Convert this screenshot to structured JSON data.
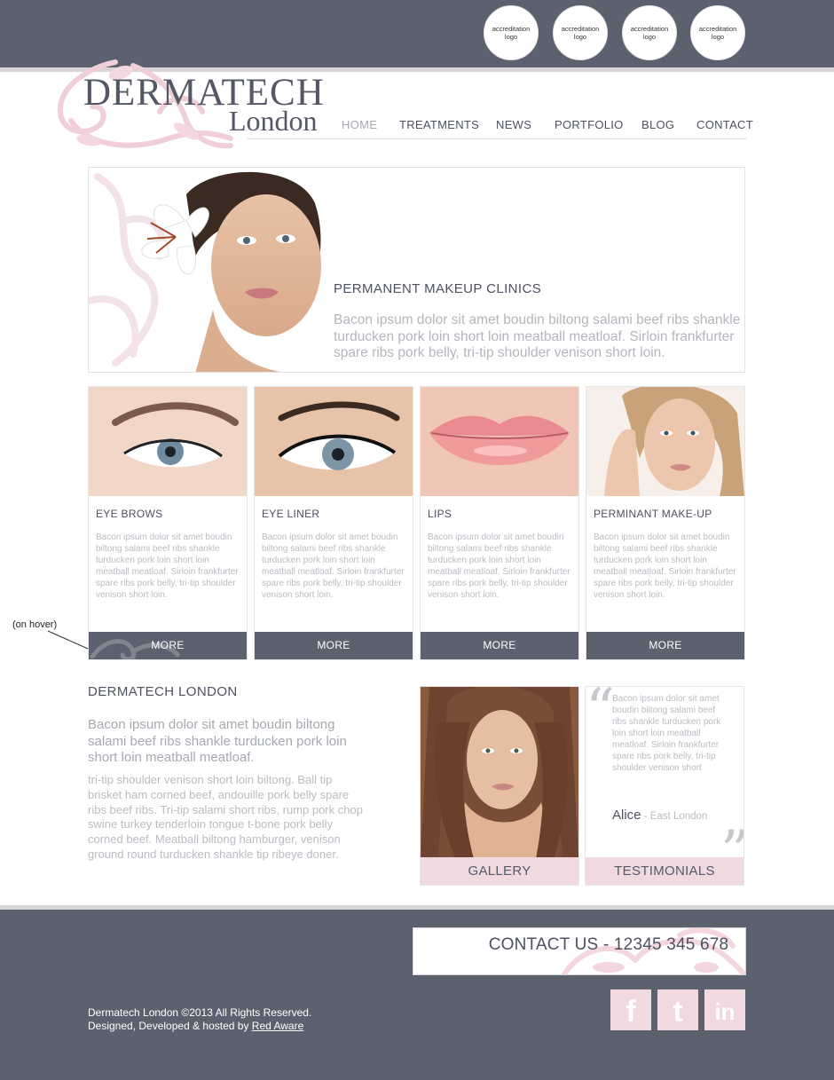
{
  "header": {
    "accreditation_logos": [
      "accreditation logo",
      "accreditation logo",
      "accreditation logo",
      "accreditation logo"
    ]
  },
  "logo": {
    "main": "DERMATECH",
    "sub": "London"
  },
  "nav": {
    "items": [
      {
        "label": "HOME",
        "active": true
      },
      {
        "label": "TREATMENTS",
        "active": false
      },
      {
        "label": "NEWS",
        "active": false
      },
      {
        "label": "PORTFOLIO",
        "active": false
      },
      {
        "label": "BLOG",
        "active": false
      },
      {
        "label": "CONTACT",
        "active": false
      }
    ]
  },
  "hero": {
    "title": "PERMANENT MAKEUP CLINICS",
    "text": "Bacon ipsum dolor sit amet boudin biltong salami beef ribs shankle turducken pork loin short loin meatball meatloaf. Sirloin frankfurter spare ribs pork belly, tri-tip shoulder venison short loin."
  },
  "cards": [
    {
      "title": "EYE BROWS",
      "text": "Bacon ipsum dolor sit amet boudin biltong salami beef ribs shankle turducken pork loin short loin meatball meatloaf. Sirloin frankfurter spare ribs pork belly, tri-tip shoulder venison short loin.",
      "more": "MORE",
      "image": "eyebrow-closeup"
    },
    {
      "title": "EYE LINER",
      "text": "Bacon ipsum dolor sit amet boudin biltong salami beef ribs shankle turducken pork loin short loin meatball meatloaf. Sirloin frankfurter spare ribs pork belly, tri-tip shoulder venison short loin.",
      "more": "MORE",
      "image": "eyeliner-closeup"
    },
    {
      "title": "LIPS",
      "text": "Bacon ipsum dolor sit amet boudin biltong salami beef ribs shankle turducken pork loin short loin meatball meatloaf. Sirloin frankfurter spare ribs pork belly, tri-tip shoulder venison short loin.",
      "more": "MORE",
      "image": "lips-closeup"
    },
    {
      "title": "PERMINANT MAKE-UP",
      "text": "Bacon ipsum dolor sit amet boudin biltong salami beef ribs shankle turducken pork loin short loin meatball meatloaf. Sirloin frankfurter spare ribs pork belly, tri-tip shoulder venison short loin.",
      "more": "MORE",
      "image": "woman-portrait"
    }
  ],
  "hover_note": "(on hover)",
  "about": {
    "title": "DERMATECH LONDON",
    "lead": "Bacon ipsum dolor sit amet boudin biltong salami beef ribs shankle turducken pork loin short loin meatball meatloaf.",
    "body": "tri-tip shoulder venison short loin biltong. Ball tip brisket ham corned beef, andouille pork belly spare ribs beef ribs. Tri-tip salami short ribs, rump pork chop swine turkey tenderloin tongue t-bone pork belly corned beef. Meatball biltong hamburger, venison ground round turducken shankle tip ribeye doner."
  },
  "gallery": {
    "label": "GALLERY"
  },
  "testimonials": {
    "label": "TESTIMONIALS",
    "quote": "Bacon ipsum dolor sit amet boudin biltong salami beef ribs shankle turducken pork loin short loin meatball meatloaf. Sirloin frankfurter spare ribs pork belly, tri-tip shoulder venison short",
    "name": "Alice",
    "location": " - East London"
  },
  "footer": {
    "contact": "CONTACT US - 12345 345 678",
    "copyright_line1": "Dermatech London ©2013 All Rights Reserved.",
    "copyright_line2_prefix": "Designed, Developed & hosted by ",
    "copyright_link": "Red Aware",
    "social": [
      {
        "name": "facebook-icon",
        "glyph": "f"
      },
      {
        "name": "twitter-icon",
        "glyph": "t"
      },
      {
        "name": "linkedin-icon",
        "glyph": "in"
      }
    ]
  },
  "colors": {
    "slate": "#5c616f",
    "pink": "#f0d9df",
    "text_dark": "#4d5160",
    "text_light": "#b9bcc2"
  }
}
